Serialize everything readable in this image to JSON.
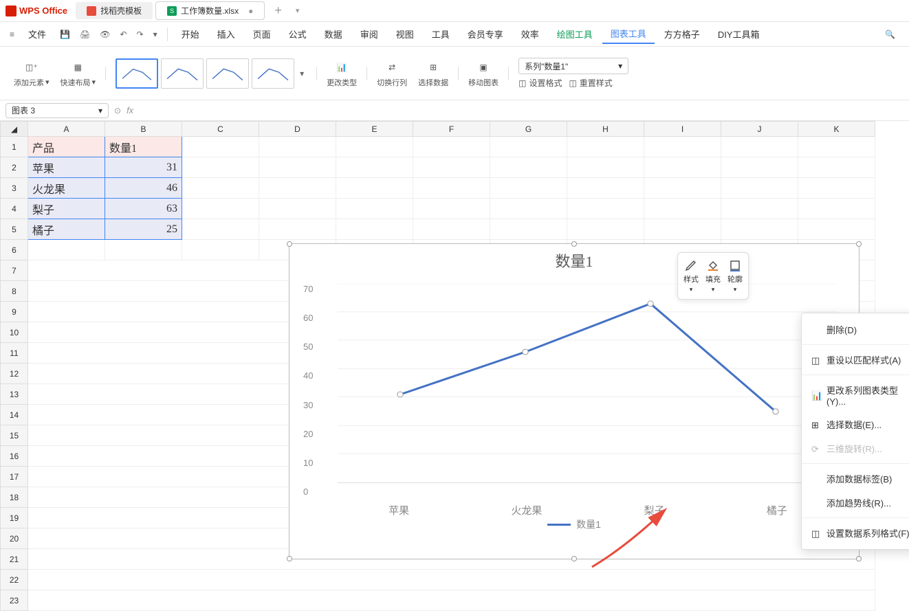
{
  "app": {
    "name": "WPS Office"
  },
  "tabs": [
    {
      "label": "找稻壳模板",
      "icon": "red"
    },
    {
      "label": "工作簿数量.xlsx",
      "icon": "green",
      "dirty": "●"
    }
  ],
  "titlebar": {
    "add": "+"
  },
  "menu": {
    "file": "文件",
    "items": [
      "开始",
      "插入",
      "页面",
      "公式",
      "数据",
      "审阅",
      "视图",
      "工具",
      "会员专享",
      "效率",
      "绘图工具",
      "图表工具",
      "方方格子",
      "DIY工具箱"
    ]
  },
  "ribbon": {
    "addElement": "添加元素",
    "quickLayout": "快速布局",
    "changeType": "更改类型",
    "switchRowCol": "切换行列",
    "selectData": "选择数据",
    "moveChart": "移动图表",
    "seriesSelect": "系列\"数量1\"",
    "setFormat": "设置格式",
    "resetStyle": "重置样式"
  },
  "formulabar": {
    "namebox": "图表 3",
    "fx": "fx"
  },
  "columns": [
    "A",
    "B",
    "C",
    "D",
    "E",
    "F",
    "G",
    "H",
    "I",
    "J",
    "K"
  ],
  "rows": [
    "1",
    "2",
    "3",
    "4",
    "5",
    "6",
    "7",
    "8",
    "9",
    "10",
    "11",
    "12",
    "13",
    "14",
    "15",
    "16",
    "17",
    "18",
    "19",
    "20",
    "21",
    "22",
    "23"
  ],
  "cells": {
    "a1": "产品",
    "b1": "数量1",
    "a2": "苹果",
    "b2": "31",
    "a3": "火龙果",
    "b3": "46",
    "a4": "梨子",
    "b4": "63",
    "a5": "橘子",
    "b5": "25"
  },
  "floatToolbar": {
    "style": "样式",
    "fill": "填充",
    "outline": "轮廓"
  },
  "contextMenu": {
    "delete": "删除(D)",
    "resetMatch": "重设以匹配样式(A)",
    "changeSeriesType": "更改系列图表类型(Y)...",
    "selectData": "选择数据(E)...",
    "rotate3d": "三维旋转(R)...",
    "addDataLabel": "添加数据标签(B)",
    "addTrendline": "添加趋势线(R)...",
    "formatSeries": "设置数据系列格式(F)..."
  },
  "chart_data": {
    "type": "line",
    "title": "数量1",
    "categories": [
      "苹果",
      "火龙果",
      "梨子",
      "橘子"
    ],
    "series": [
      {
        "name": "数量1",
        "values": [
          31,
          46,
          63,
          25
        ]
      }
    ],
    "xlabel": "",
    "ylabel": "",
    "ylim": [
      0,
      70
    ],
    "yticks": [
      0,
      10,
      20,
      30,
      40,
      50,
      60,
      70
    ],
    "legend": "数量1",
    "legend_position": "bottom"
  }
}
